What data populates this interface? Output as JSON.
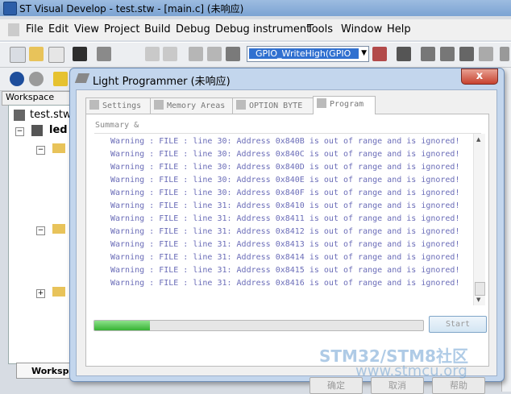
{
  "window": {
    "title": "ST Visual Develop - test.stw - [main.c] (未响应)"
  },
  "menu": [
    "File",
    "Edit",
    "View",
    "Project",
    "Build",
    "Debug",
    "Debug instrument",
    "Tools",
    "Window",
    "Help"
  ],
  "toolbar": {
    "function_combo": "GPIO_WriteHigh(GPIO"
  },
  "workspace": {
    "label": "Workspace",
    "root": "test.stw",
    "project": "led",
    "tab": "Workspace"
  },
  "dialog": {
    "title": "Light Programmer (未响应)",
    "close": "x",
    "tabs": [
      "Settings",
      "Memory Areas",
      "OPTION BYTE",
      "Program"
    ],
    "active_tab": "Program",
    "summary_label": "Summary &",
    "log_lines": [
      "Warning : FILE : line 30: Address 0x840B is out of range and is ignored!",
      "Warning : FILE : line 30: Address 0x840C is out of range and is ignored!",
      "Warning : FILE : line 30: Address 0x840D is out of range and is ignored!",
      "Warning : FILE : line 30: Address 0x840E is out of range and is ignored!",
      "Warning : FILE : line 30: Address 0x840F is out of range and is ignored!",
      "Warning : FILE : line 31: Address 0x8410 is out of range and is ignored!",
      "Warning : FILE : line 31: Address 0x8411 is out of range and is ignored!",
      "Warning : FILE : line 31: Address 0x8412 is out of range and is ignored!",
      "Warning : FILE : line 31: Address 0x8413 is out of range and is ignored!",
      "Warning : FILE : line 31: Address 0x8414 is out of range and is ignored!",
      "Warning : FILE : line 31: Address 0x8415 is out of range and is ignored!",
      "Warning : FILE : line 31: Address 0x8416 is out of range and is ignored!"
    ],
    "progress_fraction": 0.17,
    "start_label": "Start",
    "ok_label": "确定",
    "cancel_label": "取消",
    "help_label": "帮助"
  },
  "watermark": {
    "line1": "STM32/STM8社区",
    "line2": "www.stmcu.org"
  },
  "colors": {
    "log_text": "#6b6db8",
    "progress_fill": "#36b233",
    "title_bar": "#7ba3d3"
  }
}
